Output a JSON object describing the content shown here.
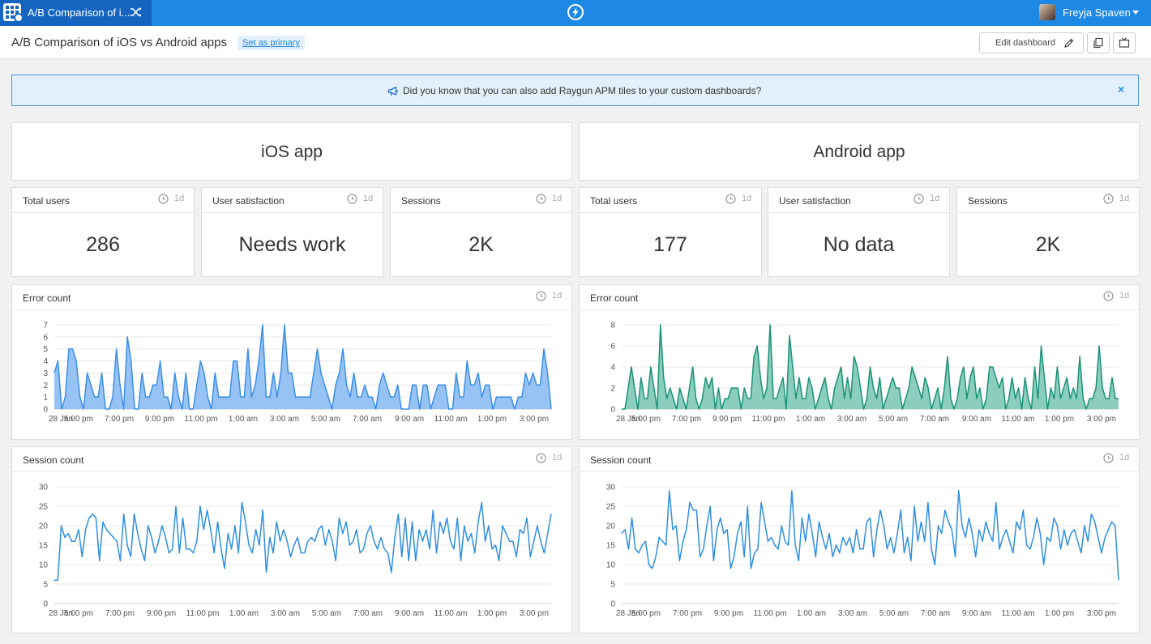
{
  "topbar": {
    "app_title": "A/B Comparison of i...",
    "user_name": "Freyja Spaven",
    "icons": [
      "app-grid-icon",
      "shuffle-icon",
      "raygun-bolt-icon",
      "caret-down-icon"
    ]
  },
  "header": {
    "title": "A/B Comparison of iOS vs Android apps",
    "set_primary": "Set as primary",
    "edit_dashboard": "Edit dashboard",
    "icons": [
      "pencil-icon",
      "duplicate-icon",
      "tv-mode-icon"
    ]
  },
  "banner": {
    "text": "Did you know that you can also add Raygun APM tiles to your custom dashboards?",
    "close": "×",
    "icon": "megaphone-icon"
  },
  "colors": {
    "accent": "#1e88e5",
    "ios_series": "#3b8ee8",
    "android_series": "#1a9277",
    "banner_bg": "#e3f0fb"
  },
  "ios": {
    "heading": "iOS app",
    "metrics": [
      {
        "label": "Total users",
        "range": "1d",
        "value": "286"
      },
      {
        "label": "User satisfaction",
        "range": "1d",
        "value": "Needs work"
      },
      {
        "label": "Sessions",
        "range": "1d",
        "value": "2K"
      }
    ],
    "error_tile": {
      "title": "Error count",
      "range": "1d"
    },
    "session_tile": {
      "title": "Session count",
      "range": "1d"
    }
  },
  "android": {
    "heading": "Android app",
    "metrics": [
      {
        "label": "Total users",
        "range": "1d",
        "value": "177"
      },
      {
        "label": "User satisfaction",
        "range": "1d",
        "value": "No data"
      },
      {
        "label": "Sessions",
        "range": "1d",
        "value": "2K"
      }
    ],
    "error_tile": {
      "title": "Error count",
      "range": "1d"
    },
    "session_tile": {
      "title": "Session count",
      "range": "1d"
    }
  },
  "chart_data": [
    {
      "id": "ios-error",
      "type": "area",
      "title": "Error count",
      "ylim": [
        0,
        7
      ],
      "yticks": [
        0,
        1,
        2,
        3,
        4,
        5,
        6,
        7
      ],
      "xticks": [
        "28 Jan",
        "5:00 pm",
        "7:00 pm",
        "9:00 pm",
        "11:00 pm",
        "1:00 am",
        "3:00 am",
        "5:00 am",
        "7:00 am",
        "9:00 am",
        "11:00 am",
        "1:00 pm",
        "3:00 pm"
      ],
      "color": "#3b8ee8",
      "fill": "#8cbcf3",
      "grid": true,
      "values": [
        3,
        4,
        0,
        1,
        5,
        5,
        4,
        1,
        0,
        3,
        2,
        1,
        1,
        3,
        0,
        0,
        1,
        5,
        2,
        0,
        6,
        4,
        0,
        0,
        3,
        1,
        1,
        2,
        2,
        4,
        1,
        1,
        0,
        3,
        1,
        0,
        3,
        0,
        0,
        2,
        4,
        3,
        1,
        0,
        3,
        1,
        1,
        1,
        1,
        4,
        4,
        1,
        1,
        5,
        1,
        2,
        4,
        7,
        1,
        1,
        3,
        1,
        3,
        7,
        3,
        3,
        1,
        1,
        1,
        1,
        1,
        3,
        5,
        3,
        2,
        1,
        0,
        2,
        3,
        5,
        2,
        1,
        3,
        1,
        1,
        2,
        1,
        1,
        0,
        2,
        3,
        2,
        1,
        1,
        2,
        0,
        0,
        0,
        2,
        2,
        0,
        2,
        2,
        0,
        1,
        2,
        2,
        2,
        0,
        0,
        3,
        1,
        1,
        4,
        2,
        2,
        3,
        1,
        2,
        2,
        0,
        1,
        1,
        1,
        1,
        1,
        0,
        1,
        1,
        3,
        2,
        3,
        2,
        2,
        5,
        3,
        0
      ]
    },
    {
      "id": "android-error",
      "type": "area",
      "title": "Error count",
      "ylim": [
        0,
        8
      ],
      "yticks": [
        0,
        2,
        4,
        6,
        8
      ],
      "xticks": [
        "28 Jan",
        "5:00 pm",
        "7:00 pm",
        "9:00 pm",
        "11:00 pm",
        "1:00 am",
        "3:00 am",
        "5:00 am",
        "7:00 am",
        "9:00 am",
        "11:00 am",
        "1:00 pm",
        "3:00 pm"
      ],
      "color": "#1a9277",
      "fill": "#7ec9b6",
      "grid": true,
      "values": [
        0,
        0,
        2,
        4,
        2,
        0,
        3,
        1,
        1,
        4,
        2,
        0,
        8,
        3,
        1,
        2,
        1,
        0,
        2,
        1,
        0,
        2,
        4,
        1,
        0,
        1,
        3,
        2,
        3,
        0,
        2,
        0,
        1,
        1,
        2,
        2,
        2,
        0,
        2,
        1,
        1,
        5,
        6,
        3,
        1,
        2,
        8,
        1,
        1,
        2,
        3,
        0,
        7,
        4,
        1,
        3,
        1,
        1,
        3,
        2,
        0,
        1,
        2,
        3,
        1,
        0,
        2,
        3,
        4,
        1,
        3,
        1,
        5,
        4,
        2,
        0,
        1,
        4,
        2,
        1,
        3,
        0,
        1,
        2,
        3,
        2,
        2,
        0,
        1,
        2,
        4,
        3,
        2,
        1,
        3,
        2,
        0,
        1,
        2,
        0,
        2,
        5,
        1,
        0,
        1,
        3,
        4,
        1,
        3,
        4,
        1,
        2,
        0,
        1,
        4,
        4,
        3,
        2,
        3,
        0,
        1,
        3,
        1,
        2,
        0,
        3,
        1,
        0,
        4,
        1,
        6,
        3,
        0,
        2,
        1,
        4,
        1,
        2,
        3,
        1,
        2,
        1,
        5,
        1,
        0,
        1,
        1,
        2,
        6,
        2,
        1,
        1,
        3,
        1,
        1
      ]
    },
    {
      "id": "ios-session",
      "type": "line",
      "title": "Session count",
      "ylim": [
        0,
        30
      ],
      "yticks": [
        0,
        5,
        10,
        15,
        20,
        25,
        30
      ],
      "xticks": [
        "28 Jan",
        "5:00 pm",
        "7:00 pm",
        "9:00 pm",
        "11:00 pm",
        "1:00 am",
        "3:00 am",
        "5:00 am",
        "7:00 am",
        "9:00 am",
        "11:00 am",
        "1:00 pm",
        "3:00 pm"
      ],
      "color": "#2f8fe0",
      "grid": true,
      "values": [
        6,
        6,
        20,
        17,
        18,
        16,
        16,
        19,
        12,
        19,
        22,
        23,
        22,
        11,
        21,
        19,
        18,
        17,
        16,
        11,
        23,
        15,
        12,
        23,
        18,
        14,
        11,
        20,
        17,
        13,
        16,
        20,
        17,
        13,
        14,
        25,
        13,
        22,
        14,
        14,
        13,
        16,
        25,
        19,
        24,
        19,
        13,
        21,
        14,
        9,
        18,
        14,
        20,
        13,
        26,
        21,
        15,
        13,
        19,
        15,
        24,
        8,
        17,
        13,
        21,
        16,
        19,
        16,
        12,
        15,
        17,
        13,
        13,
        16,
        17,
        16,
        19,
        20,
        15,
        19,
        16,
        11,
        22,
        18,
        21,
        15,
        16,
        19,
        13,
        14,
        18,
        20,
        16,
        14,
        17,
        14,
        13,
        8,
        17,
        23,
        12,
        22,
        11,
        21,
        11,
        19,
        16,
        19,
        14,
        24,
        13,
        21,
        18,
        22,
        16,
        14,
        22,
        11,
        20,
        16,
        18,
        13,
        21,
        26,
        16,
        20,
        14,
        15,
        11,
        20,
        18,
        16,
        16,
        12,
        19,
        18,
        22,
        12,
        16,
        20,
        16,
        13,
        18,
        23
      ]
    },
    {
      "id": "android-session",
      "type": "line",
      "title": "Session count",
      "ylim": [
        0,
        30
      ],
      "yticks": [
        0,
        5,
        10,
        15,
        20,
        25,
        30
      ],
      "xticks": [
        "28 Jan",
        "5:00 pm",
        "7:00 pm",
        "9:00 pm",
        "11:00 pm",
        "1:00 am",
        "3:00 am",
        "5:00 am",
        "7:00 am",
        "9:00 am",
        "11:00 am",
        "1:00 pm",
        "3:00 pm"
      ],
      "color": "#2f8fe0",
      "grid": true,
      "values": [
        18,
        19,
        14,
        22,
        14,
        13,
        15,
        16,
        10,
        9,
        12,
        17,
        16,
        15,
        29,
        19,
        20,
        11,
        16,
        19,
        26,
        24,
        24,
        12,
        14,
        20,
        25,
        11,
        19,
        22,
        18,
        19,
        9,
        12,
        18,
        21,
        12,
        25,
        9,
        13,
        14,
        26,
        21,
        16,
        17,
        15,
        14,
        20,
        16,
        15,
        29,
        15,
        11,
        22,
        16,
        23,
        18,
        12,
        21,
        17,
        14,
        18,
        12,
        15,
        13,
        17,
        15,
        17,
        13,
        19,
        14,
        14,
        21,
        22,
        12,
        19,
        24,
        20,
        14,
        17,
        13,
        18,
        24,
        13,
        17,
        11,
        25,
        16,
        21,
        16,
        26,
        14,
        10,
        20,
        18,
        24,
        21,
        19,
        12,
        29,
        20,
        17,
        22,
        18,
        12,
        19,
        16,
        21,
        18,
        16,
        26,
        14,
        17,
        19,
        16,
        13,
        21,
        19,
        24,
        15,
        14,
        17,
        22,
        18,
        10,
        17,
        16,
        22,
        20,
        14,
        19,
        15,
        18,
        19,
        16,
        13,
        20,
        16,
        23,
        21,
        17,
        13,
        17,
        19,
        21,
        20,
        6
      ]
    }
  ]
}
